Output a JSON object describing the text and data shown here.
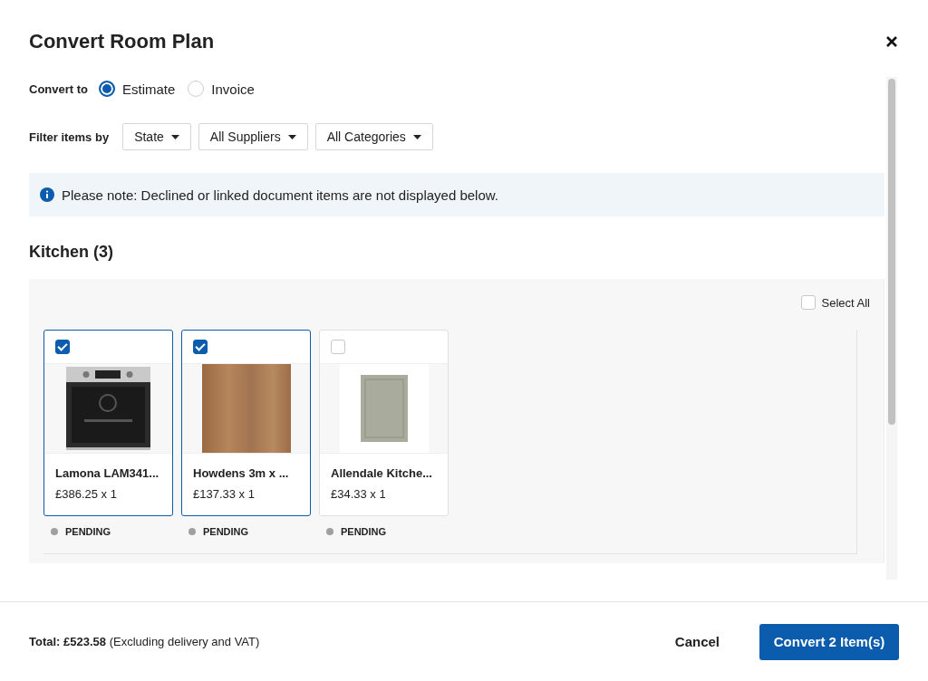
{
  "dialog": {
    "title": "Convert Room Plan"
  },
  "convert_to": {
    "label": "Convert to",
    "options": [
      {
        "label": "Estimate",
        "selected": true
      },
      {
        "label": "Invoice",
        "selected": false
      }
    ]
  },
  "filters": {
    "label": "Filter items by",
    "dropdowns": [
      {
        "label": "State"
      },
      {
        "label": "All Suppliers"
      },
      {
        "label": "All Categories"
      }
    ]
  },
  "notice": "Please note: Declined or linked document items are not displayed below.",
  "room": {
    "heading": "Kitchen (3)",
    "select_all": {
      "label": "Select All",
      "checked": false
    },
    "items": [
      {
        "kind": "oven",
        "name": "Lamona LAM341...",
        "price": "£386.25 x 1",
        "status": "PENDING",
        "checked": true
      },
      {
        "kind": "wood",
        "name": "Howdens 3m x ...",
        "price": "£137.33 x 1",
        "status": "PENDING",
        "checked": true
      },
      {
        "kind": "door",
        "name": "Allendale Kitche...",
        "price": "£34.33 x 1",
        "status": "PENDING",
        "checked": false
      }
    ]
  },
  "footer": {
    "total": "**Total: £523.58** (Excluding delivery and VAT)",
    "cancel": "Cancel",
    "convert": "Convert 2 Item(s)"
  }
}
